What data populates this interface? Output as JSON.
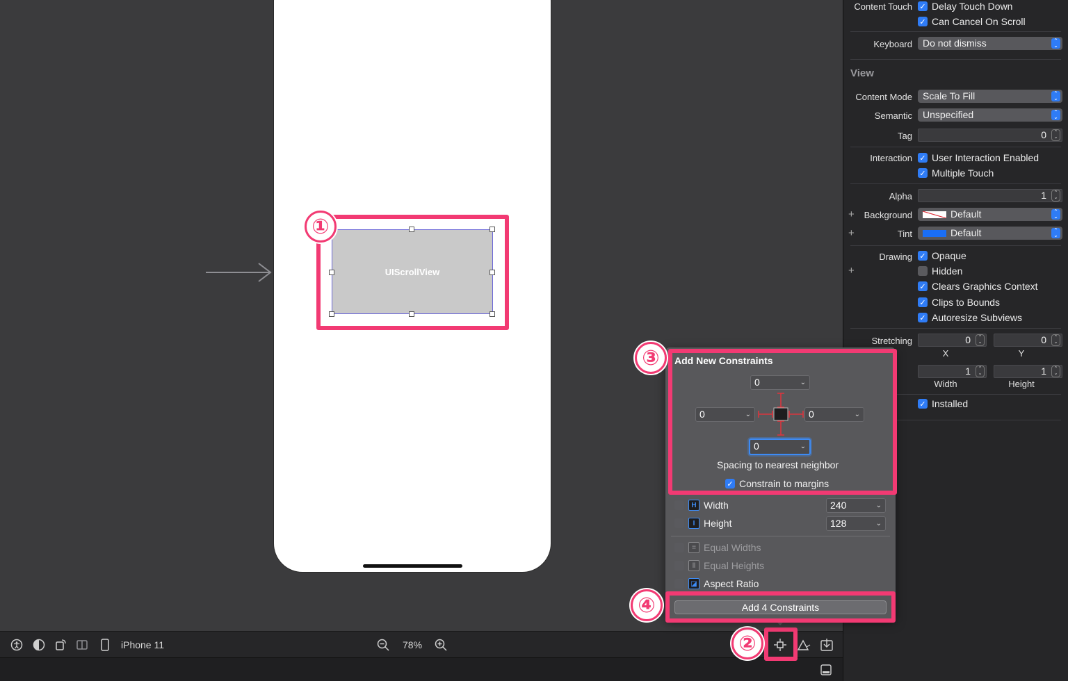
{
  "canvas": {
    "scroll_view_label": "UIScrollView"
  },
  "badges": [
    "①",
    "②",
    "③",
    "④"
  ],
  "toolbar": {
    "device": "iPhone 11",
    "zoom": "78%"
  },
  "inspector": {
    "content_touch_label": "Content Touch",
    "delay_touch_down": "Delay Touch Down",
    "can_cancel_on_scroll": "Can Cancel On Scroll",
    "keyboard_label": "Keyboard",
    "keyboard_value": "Do not dismiss",
    "view_section": "View",
    "content_mode_label": "Content Mode",
    "content_mode_value": "Scale To Fill",
    "semantic_label": "Semantic",
    "semantic_value": "Unspecified",
    "tag_label": "Tag",
    "tag_value": "0",
    "interaction_label": "Interaction",
    "user_interaction_enabled": "User Interaction Enabled",
    "multiple_touch": "Multiple Touch",
    "alpha_label": "Alpha",
    "alpha_value": "1",
    "background_label": "Background",
    "background_value": "Default",
    "tint_label": "Tint",
    "tint_value": "Default",
    "tint_color": "#1a6ef5",
    "drawing_label": "Drawing",
    "opaque": "Opaque",
    "hidden": "Hidden",
    "clears_graphics_context": "Clears Graphics Context",
    "clips_to_bounds": "Clips to Bounds",
    "autoresize_subviews": "Autoresize Subviews",
    "stretching_label": "Stretching",
    "stretch_x_value": "0",
    "stretch_y_value": "0",
    "stretch_x_label": "X",
    "stretch_y_label": "Y",
    "stretch_w_value": "1",
    "stretch_h_value": "1",
    "stretch_w_label": "Width",
    "stretch_h_label": "Height",
    "installed": "Installed"
  },
  "constraints": {
    "title": "Add New Constraints",
    "top": "0",
    "left": "0",
    "right": "0",
    "bottom": "0",
    "spacing_caption": "Spacing to nearest neighbor",
    "constrain_to_margins": "Constrain to margins",
    "width_label": "Width",
    "width_value": "240",
    "height_label": "Height",
    "height_value": "128",
    "equal_widths": "Equal Widths",
    "equal_heights": "Equal Heights",
    "aspect_ratio": "Aspect Ratio",
    "add_button": "Add 4 Constraints"
  },
  "colors": {
    "highlight": "#f23a73",
    "accent": "#2f7cf6",
    "constraint_red": "#d9363e"
  }
}
